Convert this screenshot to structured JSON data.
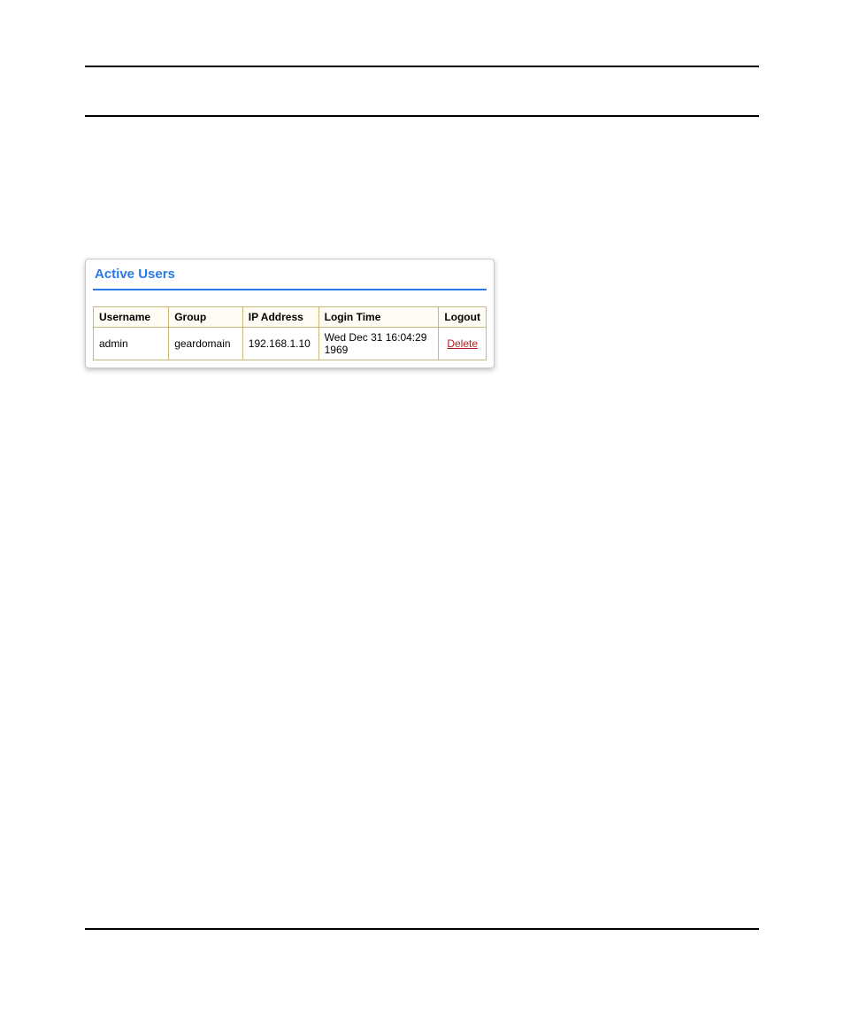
{
  "panel": {
    "title": "Active Users",
    "columns": {
      "username": "Username",
      "group": "Group",
      "ip": "IP Address",
      "login": "Login Time",
      "logout": "Logout"
    },
    "rows": [
      {
        "username": "admin",
        "group": "geardomain",
        "ip": "192.168.1.10",
        "login": "Wed Dec 31 16:04:29 1969",
        "logout_action": "Delete"
      }
    ]
  }
}
